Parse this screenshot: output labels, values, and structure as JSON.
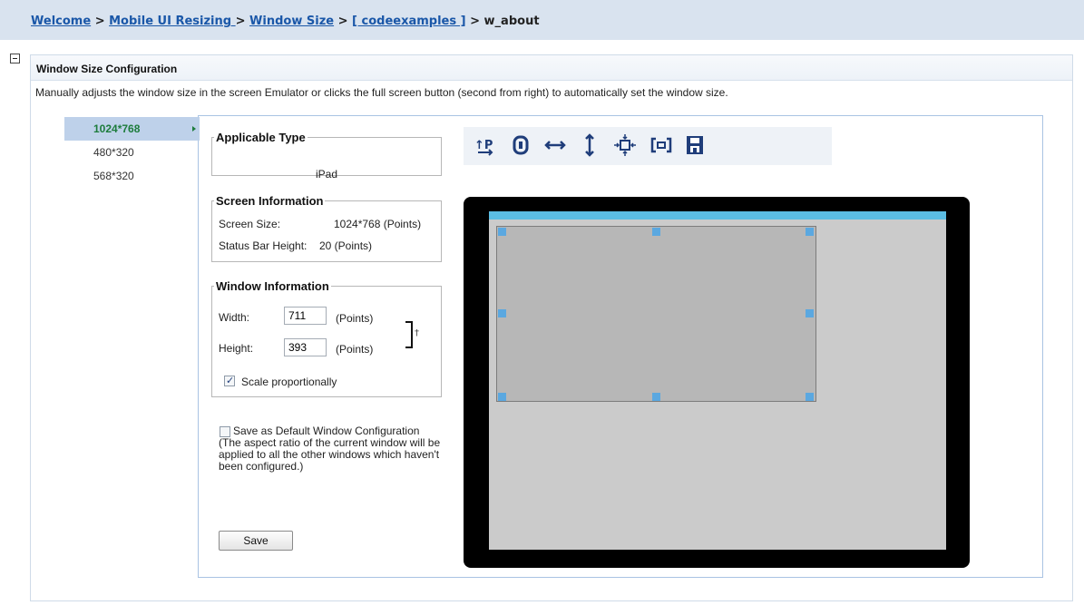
{
  "breadcrumb": {
    "items": [
      "Welcome",
      "Mobile UI Resizing ",
      "Window Size",
      "[ codeexamples ]"
    ],
    "separator": ">",
    "current": "w_about"
  },
  "panel": {
    "title": "Window Size Configuration",
    "description": "Manually adjusts the window size in the screen Emulator or clicks the full screen button (second from right) to automatically set the window size."
  },
  "sizes": {
    "items": [
      "1024*768",
      "480*320",
      "568*320"
    ],
    "selected": "1024*768"
  },
  "applicable_type": {
    "legend": "Applicable Type",
    "value": "iPad"
  },
  "screen_info": {
    "legend": "Screen Information",
    "screen_size_label": "Screen Size:",
    "screen_size_value": "1024*768 (Points)",
    "status_bar_label": "Status Bar Height:",
    "status_bar_value": "20 (Points)"
  },
  "window_info": {
    "legend": "Window Information",
    "width_label": "Width:",
    "width_value": "711",
    "width_unit": "(Points)",
    "height_label": "Height:",
    "height_value": "393",
    "height_unit": "(Points)",
    "scale_label": "Scale proportionally",
    "scale_checked": true
  },
  "default_config": {
    "label": "Save as Default Window Configuration (The aspect ratio of the current window will be applied to all the other windows which haven't been configured.)",
    "checked": false
  },
  "save_label": "Save",
  "toolbar": {
    "tools": [
      "portrait-rotate-icon",
      "lock-aspect-icon",
      "fit-width-icon",
      "fit-height-icon",
      "center-icon",
      "full-screen-icon",
      "save-disk-icon"
    ]
  },
  "colors": {
    "status_bar": "#5bbde3",
    "handle": "#5ba8e0",
    "selected_nav": "#bed1ea",
    "link": "#1a57a8"
  }
}
